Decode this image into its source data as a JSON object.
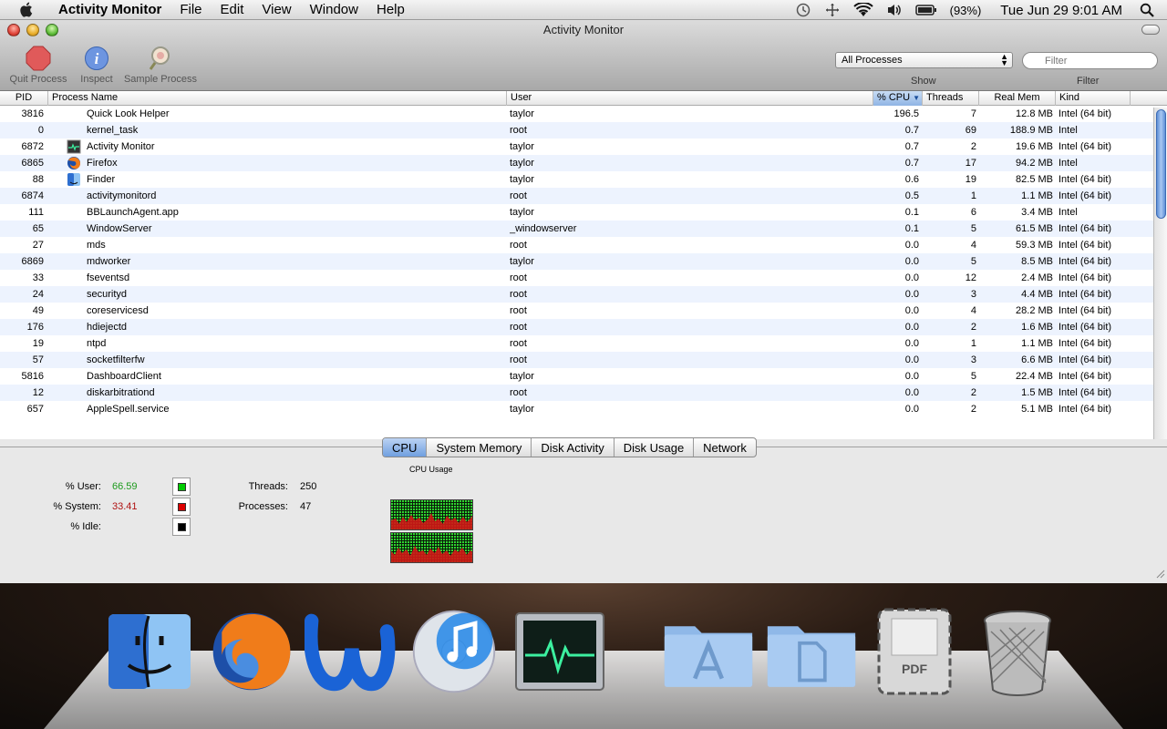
{
  "menubar": {
    "app_name": "Activity Monitor",
    "items": [
      "File",
      "Edit",
      "View",
      "Window",
      "Help"
    ],
    "battery": "(93%)",
    "clock": "Tue Jun 29  9:01 AM"
  },
  "window": {
    "title": "Activity Monitor",
    "toolbar": {
      "quit_label": "Quit Process",
      "inspect_label": "Inspect",
      "sample_label": "Sample Process",
      "show_value": "All Processes",
      "show_label": "Show",
      "filter_placeholder": "Filter",
      "filter_label": "Filter"
    }
  },
  "table": {
    "headers": {
      "pid": "PID",
      "name": "Process Name",
      "user": "User",
      "cpu": "% CPU",
      "threads": "Threads",
      "mem": "Real Mem",
      "kind": "Kind"
    },
    "rows": [
      {
        "pid": "3816",
        "name": "Quick Look Helper",
        "user": "taylor",
        "cpu": "196.5",
        "threads": "7",
        "mem": "12.8 MB",
        "kind": "Intel (64 bit)",
        "icon": ""
      },
      {
        "pid": "0",
        "name": "kernel_task",
        "user": "root",
        "cpu": "0.7",
        "threads": "69",
        "mem": "188.9 MB",
        "kind": "Intel",
        "icon": ""
      },
      {
        "pid": "6872",
        "name": "Activity Monitor",
        "user": "taylor",
        "cpu": "0.7",
        "threads": "2",
        "mem": "19.6 MB",
        "kind": "Intel (64 bit)",
        "icon": "activity-monitor-icon"
      },
      {
        "pid": "6865",
        "name": "Firefox",
        "user": "taylor",
        "cpu": "0.7",
        "threads": "17",
        "mem": "94.2 MB",
        "kind": "Intel",
        "icon": "firefox-icon"
      },
      {
        "pid": "88",
        "name": "Finder",
        "user": "taylor",
        "cpu": "0.6",
        "threads": "19",
        "mem": "82.5 MB",
        "kind": "Intel (64 bit)",
        "icon": "finder-icon"
      },
      {
        "pid": "6874",
        "name": "activitymonitord",
        "user": "root",
        "cpu": "0.5",
        "threads": "1",
        "mem": "1.1 MB",
        "kind": "Intel (64 bit)",
        "icon": ""
      },
      {
        "pid": "111",
        "name": "BBLaunchAgent.app",
        "user": "taylor",
        "cpu": "0.1",
        "threads": "6",
        "mem": "3.4 MB",
        "kind": "Intel",
        "icon": ""
      },
      {
        "pid": "65",
        "name": "WindowServer",
        "user": "_windowserver",
        "cpu": "0.1",
        "threads": "5",
        "mem": "61.5 MB",
        "kind": "Intel (64 bit)",
        "icon": ""
      },
      {
        "pid": "27",
        "name": "mds",
        "user": "root",
        "cpu": "0.0",
        "threads": "4",
        "mem": "59.3 MB",
        "kind": "Intel (64 bit)",
        "icon": ""
      },
      {
        "pid": "6869",
        "name": "mdworker",
        "user": "taylor",
        "cpu": "0.0",
        "threads": "5",
        "mem": "8.5 MB",
        "kind": "Intel (64 bit)",
        "icon": ""
      },
      {
        "pid": "33",
        "name": "fseventsd",
        "user": "root",
        "cpu": "0.0",
        "threads": "12",
        "mem": "2.4 MB",
        "kind": "Intel (64 bit)",
        "icon": ""
      },
      {
        "pid": "24",
        "name": "securityd",
        "user": "root",
        "cpu": "0.0",
        "threads": "3",
        "mem": "4.4 MB",
        "kind": "Intel (64 bit)",
        "icon": ""
      },
      {
        "pid": "49",
        "name": "coreservicesd",
        "user": "root",
        "cpu": "0.0",
        "threads": "4",
        "mem": "28.2 MB",
        "kind": "Intel (64 bit)",
        "icon": ""
      },
      {
        "pid": "176",
        "name": "hdiejectd",
        "user": "root",
        "cpu": "0.0",
        "threads": "2",
        "mem": "1.6 MB",
        "kind": "Intel (64 bit)",
        "icon": ""
      },
      {
        "pid": "19",
        "name": "ntpd",
        "user": "root",
        "cpu": "0.0",
        "threads": "1",
        "mem": "1.1 MB",
        "kind": "Intel (64 bit)",
        "icon": ""
      },
      {
        "pid": "57",
        "name": "socketfilterfw",
        "user": "root",
        "cpu": "0.0",
        "threads": "3",
        "mem": "6.6 MB",
        "kind": "Intel (64 bit)",
        "icon": ""
      },
      {
        "pid": "5816",
        "name": "DashboardClient",
        "user": "taylor",
        "cpu": "0.0",
        "threads": "5",
        "mem": "22.4 MB",
        "kind": "Intel (64 bit)",
        "icon": ""
      },
      {
        "pid": "12",
        "name": "diskarbitrationd",
        "user": "root",
        "cpu": "0.0",
        "threads": "2",
        "mem": "1.5 MB",
        "kind": "Intel (64 bit)",
        "icon": ""
      },
      {
        "pid": "657",
        "name": "AppleSpell.service",
        "user": "taylor",
        "cpu": "0.0",
        "threads": "2",
        "mem": "5.1 MB",
        "kind": "Intel (64 bit)",
        "icon": ""
      }
    ]
  },
  "tabs": [
    {
      "label": "CPU",
      "active": true
    },
    {
      "label": "System Memory",
      "active": false
    },
    {
      "label": "Disk Activity",
      "active": false
    },
    {
      "label": "Disk Usage",
      "active": false
    },
    {
      "label": "Network",
      "active": false
    }
  ],
  "cpu_panel": {
    "user_label": "% User:",
    "user_value": "66.59",
    "system_label": "% System:",
    "system_value": "33.41",
    "idle_label": "% Idle:",
    "threads_label": "Threads:",
    "threads_value": "250",
    "processes_label": "Processes:",
    "processes_value": "47",
    "graph_title": "CPU Usage",
    "colors": {
      "user": "#00cc00",
      "system": "#dd0000",
      "idle": "#000000"
    }
  },
  "dock": {
    "items": [
      "finder-icon",
      "firefox-icon",
      "word-icon",
      "itunes-icon",
      "activity-monitor-icon",
      "applications-folder-icon",
      "documents-folder-icon",
      "pdf-icon",
      "trash-icon"
    ],
    "pdf_label": "PDF"
  }
}
